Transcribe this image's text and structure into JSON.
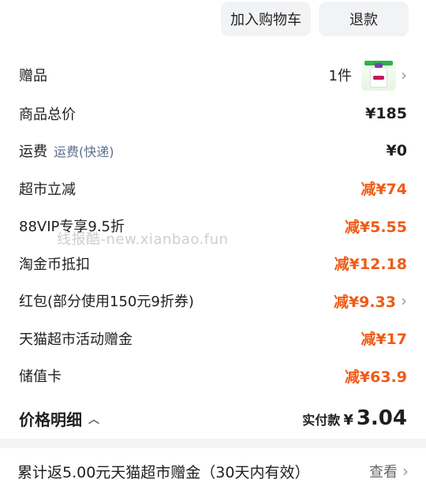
{
  "top_actions": {
    "add_to_cart": "加入购物车",
    "refund": "退款"
  },
  "rows": [
    {
      "label": "赠品",
      "count": "1件"
    },
    {
      "label": "商品总价",
      "value": "¥185"
    },
    {
      "label": "运费",
      "sublabel": "运费(快递)",
      "value": "¥0"
    },
    {
      "label": "超市立减",
      "value": "减¥74"
    },
    {
      "label": "88VIP专享9.5折",
      "value": "减¥5.55"
    },
    {
      "label": "淘金币抵扣",
      "value": "减¥12.18"
    },
    {
      "label": "红包(部分使用150元9折券)",
      "value": "减¥9.33"
    },
    {
      "label": "天猫超市活动赠金",
      "value": "减¥17"
    },
    {
      "label": "储值卡",
      "value": "减¥63.9"
    }
  ],
  "watermark": "线报酷-new.xianbao.fun",
  "price_detail": {
    "title": "价格明细",
    "paid_label": "实付款",
    "currency": "¥",
    "amount": "3.04"
  },
  "bonus": {
    "text": "累计返5.00元天猫超市赠金（30天内有效）",
    "link": "查看"
  },
  "icons": {
    "chevron": "chevron-right-icon",
    "caret": "caret-up-icon"
  },
  "colors": {
    "discount": "#f15a16",
    "sublabel": "#5b6f8e",
    "button_bg": "#f2f3f5"
  }
}
